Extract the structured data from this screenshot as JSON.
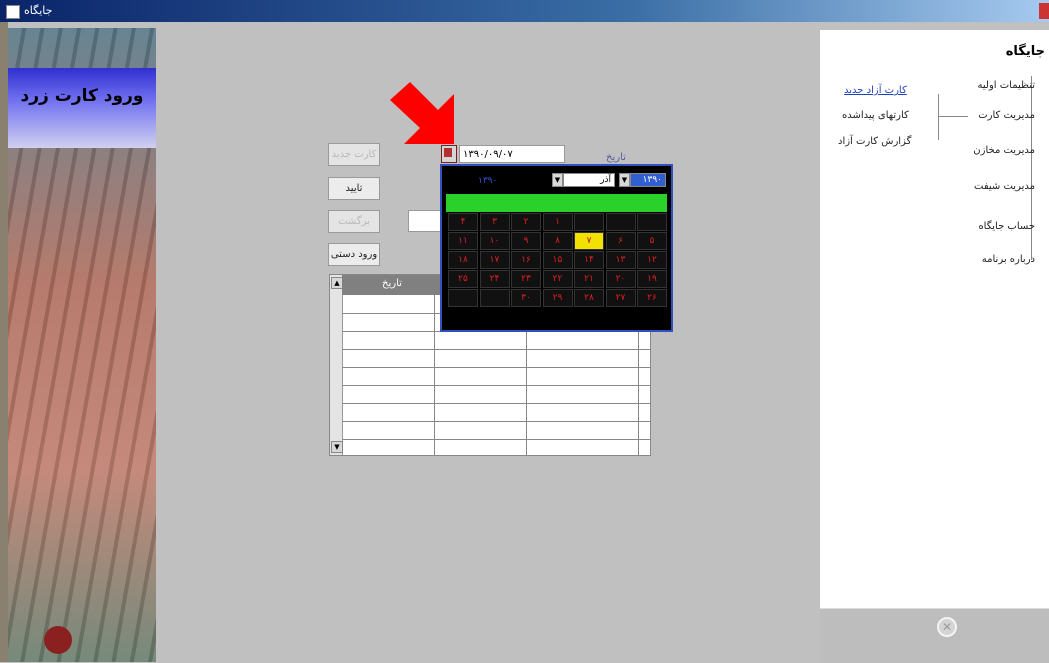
{
  "window": {
    "title": "جایگاه"
  },
  "banner": {
    "caption": "ورود کارت زرد"
  },
  "side_menu": {
    "heading": "جایگاه",
    "items": [
      {
        "label": "تنظیمات اولیه"
      },
      {
        "label": "مدیریت کارت"
      },
      {
        "label": "مدیریت مخازن"
      },
      {
        "label": "مدیریت شیفت"
      },
      {
        "label": "حساب جایگاه"
      },
      {
        "label": "درباره برنامه"
      }
    ],
    "card_submenu": [
      {
        "label": "کارت آزاد جدید",
        "active": true
      },
      {
        "label": "کارتهای پیداشده"
      },
      {
        "label": "گزارش کارت آزاد"
      }
    ]
  },
  "form": {
    "buttons": {
      "new_card": "کارت جدید",
      "confirm": "تایید",
      "return": "برگشت",
      "manual_entry": "ورود دستی"
    },
    "date_label": "تاریخ",
    "date_value": "۱۳۹۰/۰۹/۰۷"
  },
  "calendar": {
    "month": "آذر",
    "year": "۱۳۹۰",
    "today_text": "۱۳۹۰",
    "day_cells": [
      "",
      "",
      "",
      "۱",
      "۲",
      "۳",
      "۴",
      "۵",
      "۶",
      "۷",
      "۸",
      "۹",
      "۱۰",
      "۱۱",
      "۱۲",
      "۱۳",
      "۱۴",
      "۱۵",
      "۱۶",
      "۱۷",
      "۱۸",
      "۱۹",
      "۲۰",
      "۲۱",
      "۲۲",
      "۲۳",
      "۲۴",
      "۲۵",
      "۲۶",
      "۲۷",
      "۲۸",
      "۲۹",
      "۳۰",
      "",
      ""
    ],
    "selected_day": "۷",
    "colors": {
      "border": "#3050c0",
      "header": "#2bd12b",
      "selected": "#f2e000",
      "text": "#e02020"
    }
  },
  "grid": {
    "columns": [
      "تاریخ",
      "",
      ""
    ],
    "row_count": 9
  },
  "footer": {
    "icon": "close-circle-icon"
  },
  "annotation": {
    "arrow_color": "#ff0000"
  }
}
